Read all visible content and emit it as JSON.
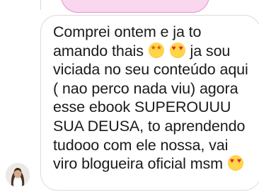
{
  "conversation": {
    "previous_bubble": {
      "color": "#f9d7ee",
      "border_color": "#ec8fd0"
    },
    "message": {
      "lines": [
        "Comprei ontem e ja to",
        "amando thais",
        "ja sou",
        "viciada no seu conteúdo aqui",
        "( nao perco nada viu) agora",
        "esse ebook SUPEROUUU",
        "SUA DEUSA, to aprendendo",
        "tudooo com ele nossa, vai",
        "viro blogueira oficial msm"
      ],
      "emojis": {
        "star_struck": "star-struck-emoji",
        "heart_eyes": "heart-eyes-emoji"
      }
    },
    "sender_avatar": "avatar-photo"
  }
}
